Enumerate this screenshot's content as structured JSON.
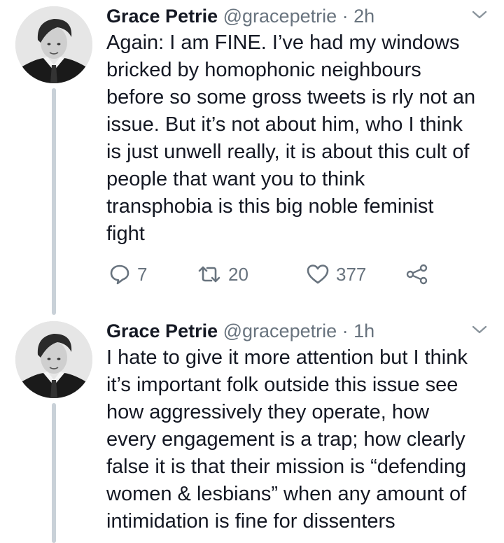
{
  "tweets": [
    {
      "author_name": "Grace Petrie",
      "handle": "@gracepetrie",
      "separator": "·",
      "time": "2h",
      "text": "Again: I am FINE. I’ve had my windows\nbricked by homophonic neighbours\nbefore so some gross tweets is rly not an\nissue. But it’s not about him, who I think\nis just unwell really, it is about this cult of\npeople that want you to think\ntransphobia is this big noble feminist\nfight",
      "replies": "7",
      "retweets": "20",
      "likes": "377"
    },
    {
      "author_name": "Grace Petrie",
      "handle": "@gracepetrie",
      "separator": "·",
      "time": "1h",
      "text": "I hate to give it more attention but I think\nit’s important folk outside this issue see\nhow aggressively they operate, how\nevery engagement is a trap; how clearly\nfalse it is that their mission is “defending\nwomen & lesbians” when any amount of\nintimidation is fine for dissenters"
    }
  ],
  "colors": {
    "text": "#141823",
    "secondary": "#68737e",
    "thread_line": "#c9d1d8"
  },
  "icons": {
    "reply": "speech-bubble",
    "retweet": "retweet-arrows",
    "like": "heart-outline",
    "share": "share-nodes",
    "more": "chevron-down"
  }
}
